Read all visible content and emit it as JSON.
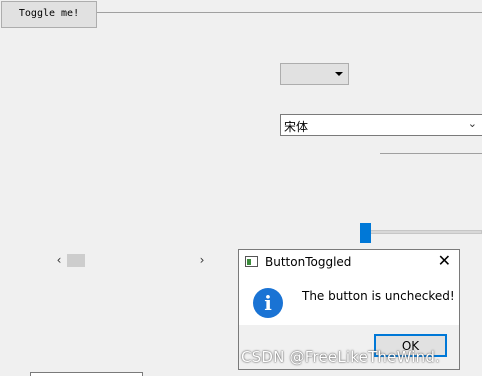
{
  "toggle_button": {
    "label": "Toggle me!"
  },
  "font_combo": {
    "value": "宋体",
    "chevron": "⌄"
  },
  "scrollbar": {
    "left_arrow": "‹",
    "right_arrow": "›"
  },
  "message_box": {
    "title": "ButtonToggled",
    "close_glyph": "✕",
    "icon_glyph": "i",
    "text": "The button is unchecked!",
    "ok_label": "OK"
  },
  "watermark": "CSDN @FreeLikeTheWind."
}
